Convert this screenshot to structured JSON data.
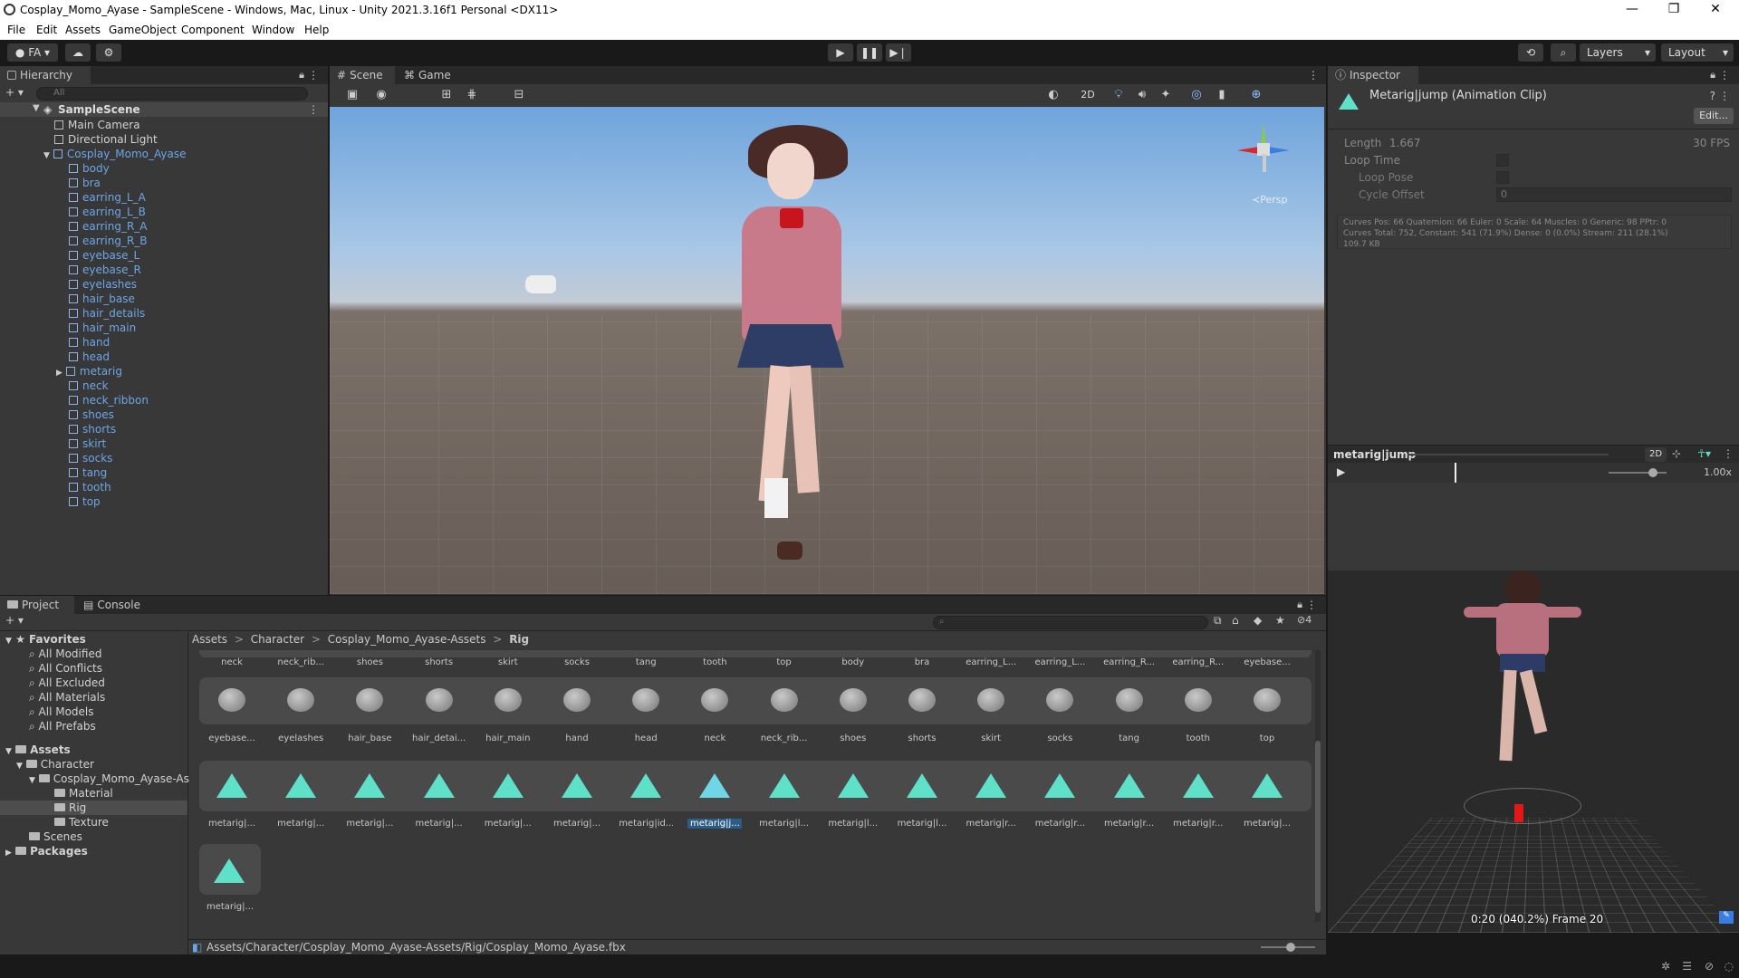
{
  "window": {
    "title": "Cosplay_Momo_Ayase - SampleScene - Windows, Mac, Linux - Unity 2021.3.16f1 Personal <DX11>",
    "min": "—",
    "max": "❐",
    "close": "✕"
  },
  "menu": [
    "File",
    "Edit",
    "Assets",
    "GameObject",
    "Component",
    "Window",
    "Help"
  ],
  "toolbar": {
    "account": "FA",
    "layers": "Layers",
    "layout": "Layout"
  },
  "hierarchy": {
    "tab": "Hierarchy",
    "search_placeholder": "All",
    "scene": "SampleScene",
    "items": [
      "Main Camera",
      "Directional Light",
      "Cosplay_Momo_Ayase",
      "body",
      "bra",
      "earring_L_A",
      "earring_L_B",
      "earring_R_A",
      "earring_R_B",
      "eyebase_L",
      "eyebase_R",
      "eyelashes",
      "hair_base",
      "hair_details",
      "hair_main",
      "hand",
      "head",
      "metarig",
      "neck",
      "neck_ribbon",
      "shoes",
      "shorts",
      "skirt",
      "socks",
      "tang",
      "tooth",
      "top"
    ]
  },
  "scene_tabs": {
    "scene": "Scene",
    "game": "Game",
    "twod": "2D",
    "persp": "≺Persp"
  },
  "inspector": {
    "tab": "Inspector",
    "title": "Metarig|jump (Animation Clip)",
    "edit": "Edit...",
    "length_label": "Length",
    "length_value": "1.667",
    "fps": "30 FPS",
    "loop_time": "Loop Time",
    "loop_pose": "Loop Pose",
    "cycle_offset": "Cycle Offset",
    "cycle_value": "0",
    "stats1": "Curves Pos: 66 Quaternion: 66 Euler: 0 Scale: 64 Muscles: 0 Generic: 98 PPtr: 0",
    "stats2": "Curves Total: 752, Constant: 541 (71.9%) Dense: 0 (0.0%) Stream: 211 (28.1%)",
    "stats3": "109.7 KB"
  },
  "preview": {
    "name": "metarig|jump",
    "twod": "2D",
    "speed": "1.00x",
    "frame": "0:20 (040.2%) Frame 20"
  },
  "project": {
    "tab": "Project",
    "console": "Console",
    "count": "4",
    "favorites_label": "Favorites",
    "favorites": [
      "All Modified",
      "All Conflicts",
      "All Excluded",
      "All Materials",
      "All Models",
      "All Prefabs"
    ],
    "assets_label": "Assets",
    "tree": [
      "Character",
      "Cosplay_Momo_Ayase-As",
      "Material",
      "Rig",
      "Texture",
      "Scenes"
    ],
    "packages": "Packages",
    "breadcrumb": [
      "Assets",
      "Character",
      "Cosplay_Momo_Ayase-Assets",
      "Rig"
    ],
    "sep": ">",
    "row1": [
      "neck",
      "neck_rib...",
      "shoes",
      "shorts",
      "skirt",
      "socks",
      "tang",
      "tooth",
      "top",
      "body",
      "bra",
      "earring_L...",
      "earring_L...",
      "earring_R...",
      "earring_R...",
      "eyebase..."
    ],
    "row2": [
      "eyebase...",
      "eyelashes",
      "hair_base",
      "hair_detai...",
      "hair_main",
      "hand",
      "head",
      "neck",
      "neck_rib...",
      "shoes",
      "shorts",
      "skirt",
      "socks",
      "tang",
      "tooth",
      "top"
    ],
    "row3": [
      "metarig|...",
      "metarig|...",
      "metarig|...",
      "metarig|...",
      "metarig|...",
      "metarig|...",
      "metarig|id...",
      "metarig|j...",
      "metarig|l...",
      "metarig|l...",
      "metarig|l...",
      "metarig|r...",
      "metarig|r...",
      "metarig|r...",
      "metarig|r...",
      "metarig|..."
    ],
    "row4": [
      "metarig|..."
    ],
    "path": "Assets/Character/Cosplay_Momo_Ayase-Assets/Rig/Cosplay_Momo_Ayase.fbx"
  },
  "colors": {
    "accent": "#5fe0c8",
    "link": "#6ba6e8",
    "selection": "#2c5d87"
  }
}
